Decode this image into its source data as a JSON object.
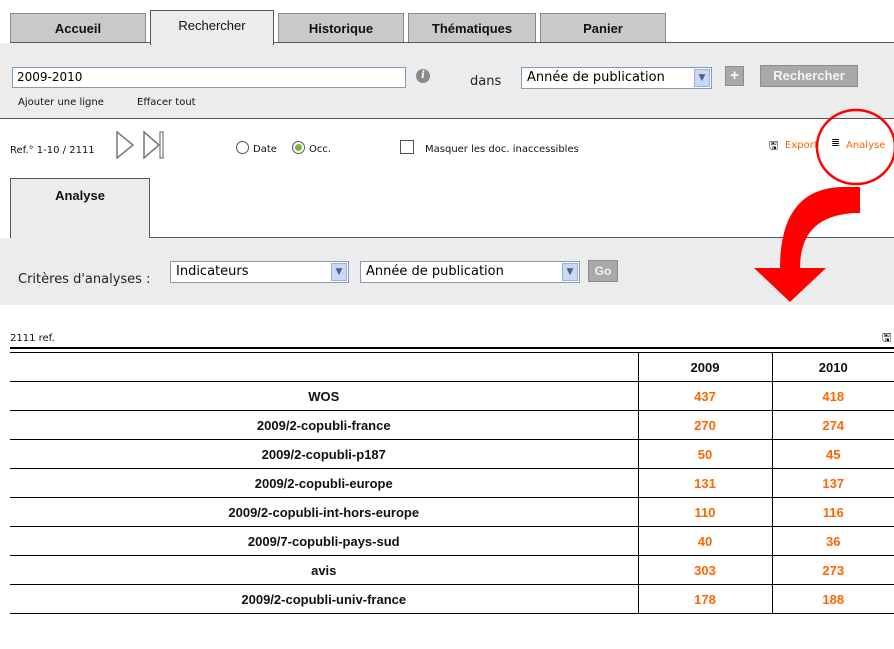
{
  "tabs": [
    {
      "label": "Accueil"
    },
    {
      "label": "Rechercher"
    },
    {
      "label": "Historique"
    },
    {
      "label": "Thématiques"
    },
    {
      "label": "Panier"
    }
  ],
  "active_tab": "Rechercher",
  "search": {
    "value": "2009-2010",
    "dans_label": "dans",
    "field_select": "Année de publication",
    "plus_label": "+",
    "search_button": "Rechercher",
    "add_line": "Ajouter une ligne",
    "clear_all": "Effacer tout"
  },
  "results_toolbar": {
    "ref_range": "Ref.° 1-10 / 2111",
    "sort_date": "Date",
    "sort_occ": "Occ.",
    "sort_selected": "Occ.",
    "hide_inaccessible": "Masquer les doc. inaccessibles",
    "export_label": "Export",
    "analyse_label": "Analyse"
  },
  "analyse": {
    "tab_label": "Analyse",
    "criteria_label": "Critères d'analyses :",
    "criteria_select": "Indicateurs",
    "field_select": "Année de publication",
    "go_button": "Go"
  },
  "table": {
    "count": "2111 ref.",
    "columns": [
      "",
      "2009",
      "2010"
    ],
    "rows": [
      {
        "label": "WOS",
        "v2009": "437",
        "v2010": "418"
      },
      {
        "label": "2009/2-copubli-france",
        "v2009": "270",
        "v2010": "274"
      },
      {
        "label": "2009/2-copubli-p187",
        "v2009": "50",
        "v2010": "45"
      },
      {
        "label": "2009/2-copubli-europe",
        "v2009": "131",
        "v2010": "137"
      },
      {
        "label": "2009/2-copubli-int-hors-europe",
        "v2009": "110",
        "v2010": "116"
      },
      {
        "label": "2009/7-copubli-pays-sud",
        "v2009": "40",
        "v2010": "36"
      },
      {
        "label": "avis",
        "v2009": "303",
        "v2010": "273"
      },
      {
        "label": "2009/2-copubli-univ-france",
        "v2009": "178",
        "v2010": "188"
      }
    ]
  },
  "colors": {
    "accent_orange": "#ff6600",
    "annotation_red": "#ff0000",
    "panel_grey": "#ececec"
  }
}
